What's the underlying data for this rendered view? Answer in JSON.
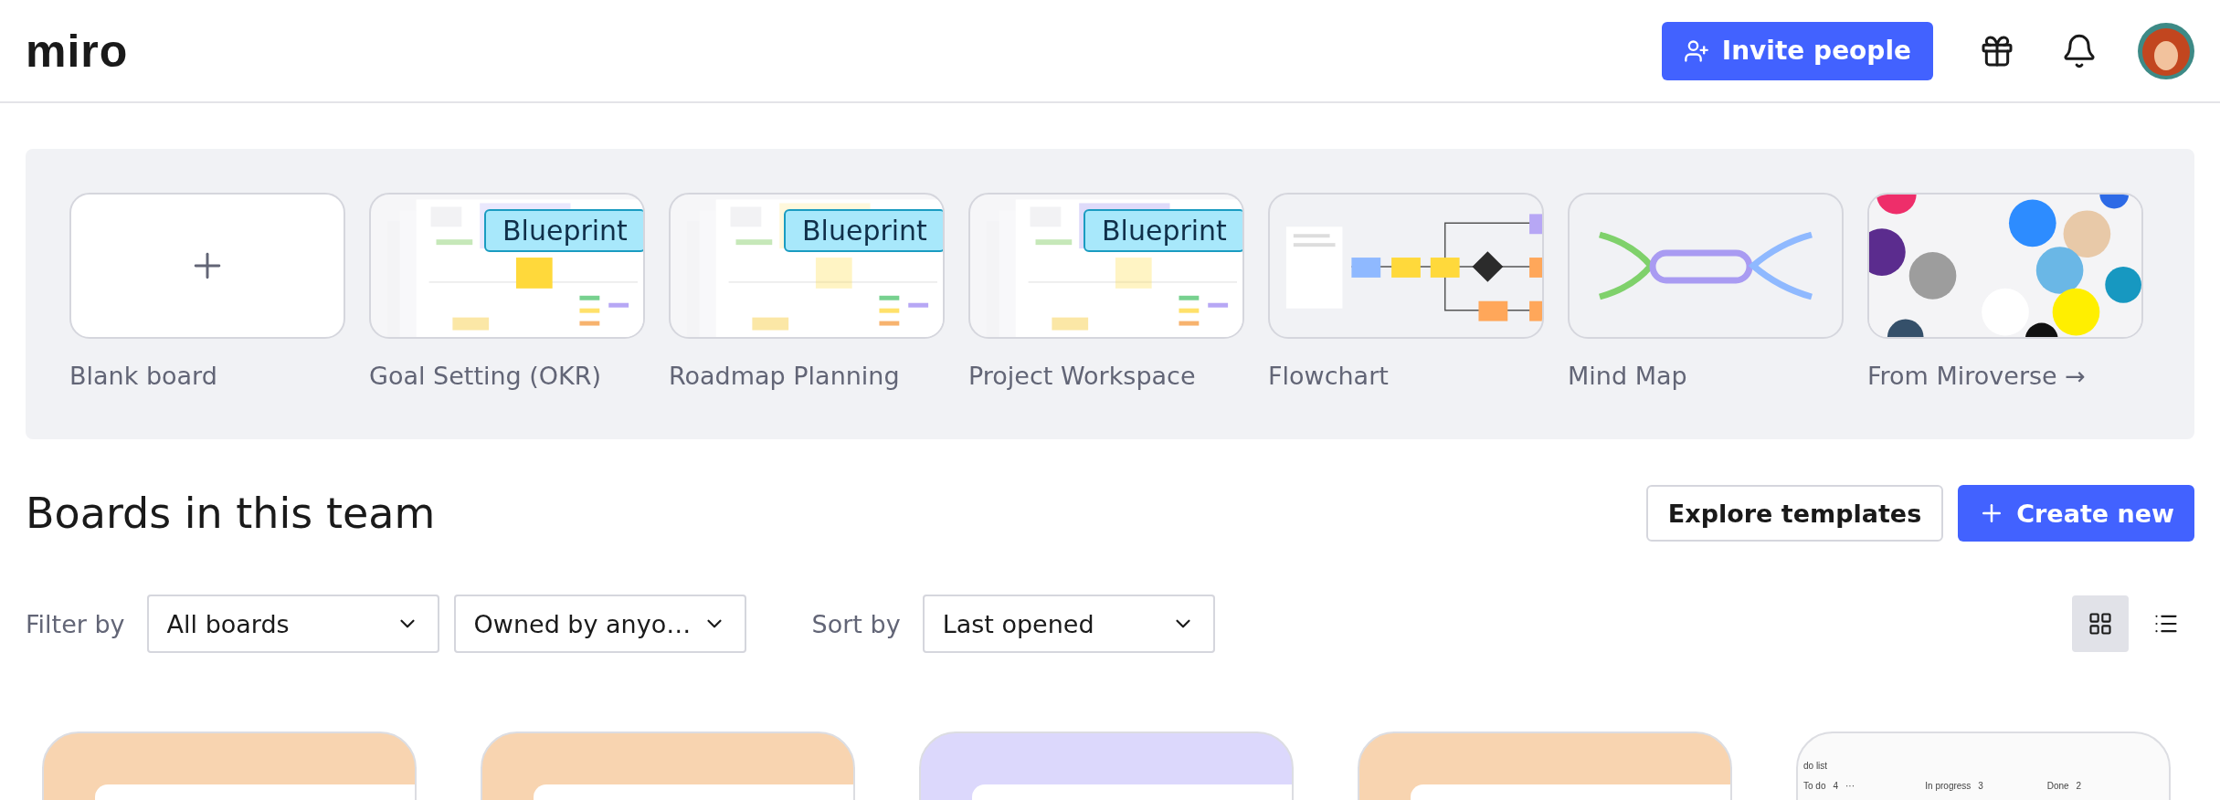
{
  "header": {
    "logo": "miro",
    "invite_button": "Invite people"
  },
  "templates": [
    {
      "kind": "blank",
      "label": "Blank board"
    },
    {
      "kind": "blueprint",
      "label": "Goal Setting (OKR)",
      "badge": "Blueprint"
    },
    {
      "kind": "blueprint",
      "label": "Roadmap Planning",
      "badge": "Blueprint"
    },
    {
      "kind": "blueprint",
      "label": "Project Workspace",
      "badge": "Blueprint"
    },
    {
      "kind": "flowchart",
      "label": "Flowchart"
    },
    {
      "kind": "mindmap",
      "label": "Mind Map"
    },
    {
      "kind": "picture",
      "label": "From Miroverse →"
    }
  ],
  "section": {
    "title": "Boards in this team",
    "explore_button": "Explore templates",
    "create_button": "Create new"
  },
  "filters": {
    "filter_label": "Filter by",
    "dropdowns": [
      "All boards",
      "Owned by anyo…"
    ],
    "sort_label": "Sort by",
    "sort_dropdown": "Last opened"
  },
  "view_toggle": [
    {
      "kind": "grid",
      "selected": true
    },
    {
      "kind": "list",
      "selected": false
    }
  ],
  "boards": [
    {
      "kind": "cover",
      "color": "#f8d4b0"
    },
    {
      "kind": "cover",
      "color": "#f8d4b0"
    },
    {
      "kind": "cover",
      "color": "#dcd8fc"
    },
    {
      "kind": "cover",
      "color": "#f8d4b0"
    },
    {
      "kind": "preview",
      "title": "do list",
      "columns": [
        {
          "name": "To do",
          "count": "4",
          "more": "···"
        },
        {
          "name": "In progress",
          "count": "3"
        },
        {
          "name": "Done",
          "count": "2"
        }
      ]
    }
  ]
}
